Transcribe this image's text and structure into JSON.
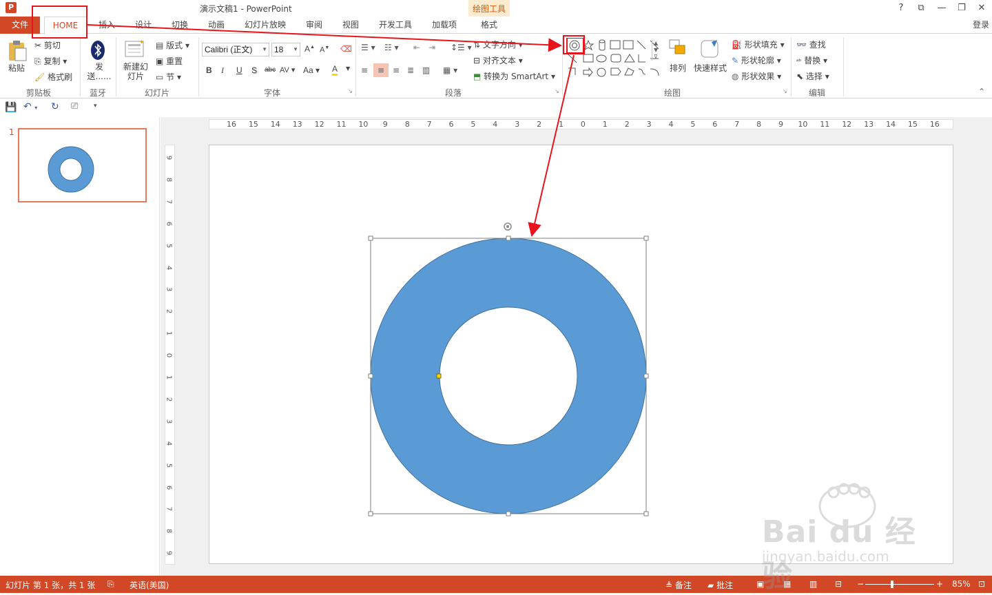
{
  "window": {
    "title": "演示文稿1 - PowerPoint",
    "app_icon": "P",
    "controls": [
      "?",
      "⧉",
      "—",
      "❐",
      "✕"
    ],
    "login": "登录"
  },
  "tabs": [
    {
      "label": "文件"
    },
    {
      "label": "HOME"
    },
    {
      "label": "插入"
    },
    {
      "label": "设计"
    },
    {
      "label": "切换"
    },
    {
      "label": "动画"
    },
    {
      "label": "幻灯片放映"
    },
    {
      "label": "审阅"
    },
    {
      "label": "视图"
    },
    {
      "label": "开发工具"
    },
    {
      "label": "加载项"
    },
    {
      "label": "格式"
    }
  ],
  "context_tab_group": "绘图工具",
  "ribbon": {
    "clipboard": {
      "paste": "粘贴",
      "cut": "剪切",
      "copy": "复制",
      "format_painter": "格式刷",
      "group": "剪贴板"
    },
    "bluetooth": {
      "send": "发送......",
      "group": "蓝牙"
    },
    "slides": {
      "new_slide": "新建幻灯片",
      "layout": "版式",
      "reset": "重置",
      "section": "节",
      "group": "幻灯片"
    },
    "font": {
      "font_name": "Calibri (正文)",
      "font_size": "18",
      "bold": "B",
      "italic": "I",
      "underline": "U",
      "shadow": "S",
      "strike": "abc",
      "spacing": "AV",
      "case": "Aa",
      "color": "A",
      "group": "字体"
    },
    "paragraph": {
      "text_direction": "文字方向",
      "align_text": "对齐文本",
      "smartart": "转换为 SmartArt",
      "group": "段落"
    },
    "drawing": {
      "arrange": "排列",
      "quick_styles": "快速样式",
      "fill": "形状填充",
      "outline": "形状轮廓",
      "effects": "形状效果",
      "group": "绘图"
    },
    "editing": {
      "find": "查找",
      "replace": "替换",
      "select": "选择",
      "group": "编辑"
    }
  },
  "thumbnails": [
    {
      "number": "1"
    }
  ],
  "ruler": {
    "h_labels": [
      "16",
      "15",
      "14",
      "13",
      "12",
      "11",
      "10",
      "9",
      "8",
      "7",
      "6",
      "5",
      "4",
      "3",
      "2",
      "1",
      "0",
      "1",
      "2",
      "3",
      "4",
      "5",
      "6",
      "7",
      "8",
      "9",
      "10",
      "11",
      "12",
      "13",
      "14",
      "15",
      "16"
    ],
    "v_labels": [
      "9",
      "8",
      "7",
      "6",
      "5",
      "4",
      "3",
      "2",
      "1",
      "0",
      "1",
      "2",
      "3",
      "4",
      "5",
      "6",
      "7",
      "8",
      "9"
    ]
  },
  "shape": {
    "type": "donut",
    "fill": "#5b9bd5",
    "outline": "#41719c"
  },
  "status": {
    "slide_info": "幻灯片 第 1 张，共 1 张",
    "language": "英语(美国)",
    "notes": "备注",
    "comments": "批注",
    "zoom": "85%"
  },
  "colors": {
    "accent": "#d24726",
    "annotation": "#e8141c",
    "context_tab": "#fdebcf"
  },
  "watermark": {
    "brand": "Bai du 经验",
    "url": "jingyan.baidu.com"
  }
}
